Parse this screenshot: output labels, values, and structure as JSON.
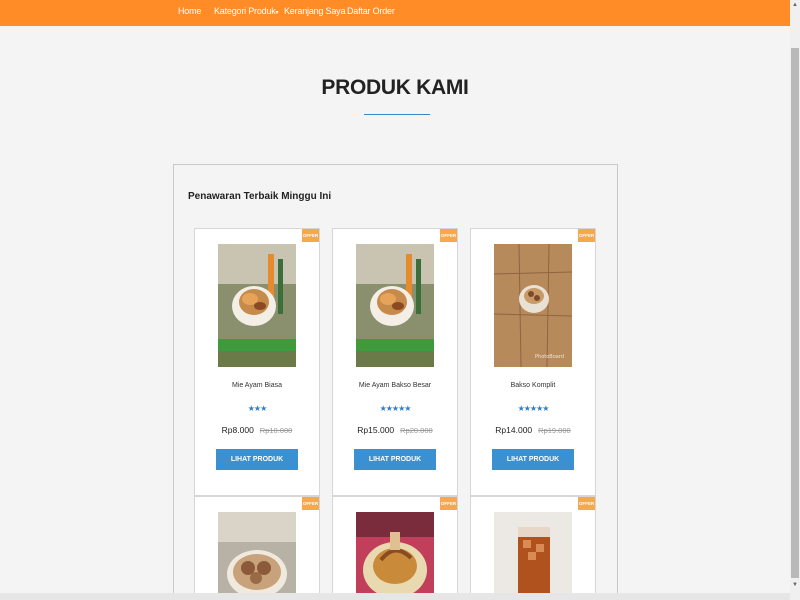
{
  "nav": {
    "items": [
      {
        "label": "Home"
      },
      {
        "label": "Kategori Produk"
      },
      {
        "label": "Keranjang Saya"
      },
      {
        "label": "Daftar Order"
      }
    ]
  },
  "page": {
    "title": "PRODUK KAMI",
    "section_heading": "Penawaran Terbaik Minggu Ini"
  },
  "products": [
    {
      "badge": "OFFER",
      "name": "Mie Ayam Biasa",
      "rating": 3,
      "stars": "★★★",
      "price": "Rp8.000",
      "old_price": "Rp10.000",
      "button": "LIHAT PRODUK"
    },
    {
      "badge": "OFFER",
      "name": "Mie Ayam Bakso Besar",
      "rating": 5,
      "stars": "★★★★★",
      "price": "Rp15.000",
      "old_price": "Rp20.000",
      "button": "LIHAT PRODUK"
    },
    {
      "badge": "OFFER",
      "name": "Bakso Komplit",
      "rating": 5,
      "stars": "★★★★★",
      "price": "Rp14.000",
      "old_price": "Rp19.000",
      "button": "LIHAT PRODUK"
    },
    {
      "badge": "OFFER"
    },
    {
      "badge": "OFFER"
    },
    {
      "badge": "OFFER"
    }
  ],
  "colors": {
    "navbar": "#ff8c26",
    "button": "#3a90d0",
    "stars": "#2f7fc2",
    "badge": "#f7a84a",
    "title_underline": "#3b86c4"
  }
}
